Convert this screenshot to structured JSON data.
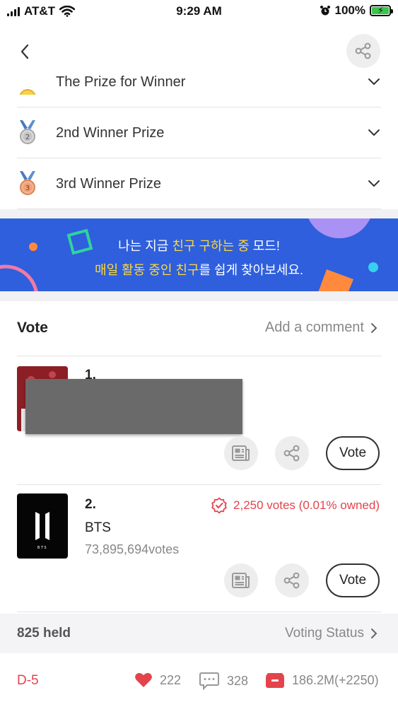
{
  "status_bar": {
    "carrier": "AT&T",
    "time": "9:29 AM",
    "battery": "100%"
  },
  "prizes": [
    {
      "label": "The Prize for Winner",
      "medal": "gold-medal-icon"
    },
    {
      "label": "2nd Winner Prize",
      "medal": "silver-medal-icon"
    },
    {
      "label": "3rd Winner Prize",
      "medal": "bronze-medal-icon"
    }
  ],
  "banner": {
    "line1_a": "나는 지금 ",
    "line1_b": "친구 구하는 중",
    "line1_c": " 모드!",
    "line2_a": "매일 활동 중인 친구",
    "line2_b": "를 쉽게 찾아보세요."
  },
  "vote": {
    "title": "Vote",
    "add_comment": "Add a comment",
    "vote_label": "Vote",
    "entries": [
      {
        "rank": "1."
      },
      {
        "rank": "2.",
        "artist": "BTS",
        "votes": "73,895,694votes",
        "owned": "2,250 votes (0.01% owned)"
      }
    ]
  },
  "held_bar": {
    "held": "825 held",
    "status_link": "Voting Status"
  },
  "footer": {
    "dday": "D-5",
    "likes": "222",
    "comments": "328",
    "tickets": "186.2M(+2250)"
  },
  "colors": {
    "accent_red": "#e4434b",
    "banner_blue": "#2f5fdc",
    "highlight_yellow": "#ffd93a"
  }
}
